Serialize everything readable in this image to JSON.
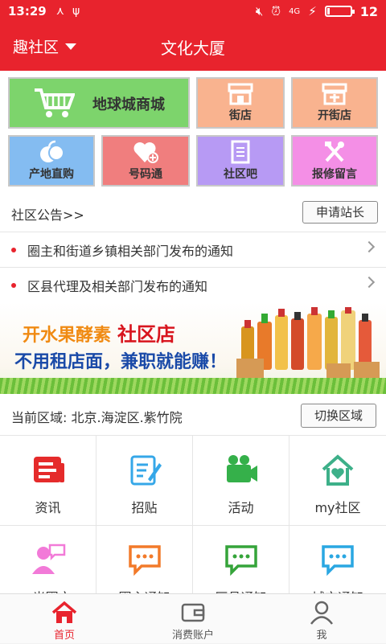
{
  "status_bar": {
    "time": "13:29",
    "network": "4G",
    "battery_level": 12,
    "battery_text": "12"
  },
  "header": {
    "community_selector": "趣社区",
    "title": "文化大厦"
  },
  "colors": {
    "brand_red": "#e8232d",
    "tile_green": "#7dd46c",
    "tile_salmon": "#f9b38f",
    "tile_blue": "#84bcf1",
    "tile_red": "#f07e7e",
    "tile_purple": "#b79af4",
    "tile_pink": "#f48fe6"
  },
  "tiles": {
    "mall": "地球城商城",
    "street_shop": "街店",
    "open_shop": "开街店",
    "origin_direct": "产地直购",
    "number_pass": "号码通",
    "community_bar": "社区吧",
    "repair_message": "报修留言"
  },
  "notice": {
    "title": "社区公告>>",
    "apply_button": "申请站长",
    "items": [
      "圈主和街道乡镇相关部门发布的通知",
      "区县代理及相关部门发布的通知"
    ]
  },
  "banner": {
    "line1": "开水果酵素",
    "line1_highlight": "社区店",
    "line2": "不用租店面，兼职就能赚！"
  },
  "region": {
    "label": "当前区域: 北京.海淀区.紫竹院",
    "switch_button": "切换区域"
  },
  "grid": {
    "row1": [
      "资讯",
      "招贴",
      "活动",
      "my社区"
    ],
    "row2": [
      ". 光圈文",
      "圈主通知",
      "区县通知",
      "城市通知"
    ]
  },
  "tabbar": {
    "home": "首页",
    "account": "消费账户",
    "me": "我"
  }
}
